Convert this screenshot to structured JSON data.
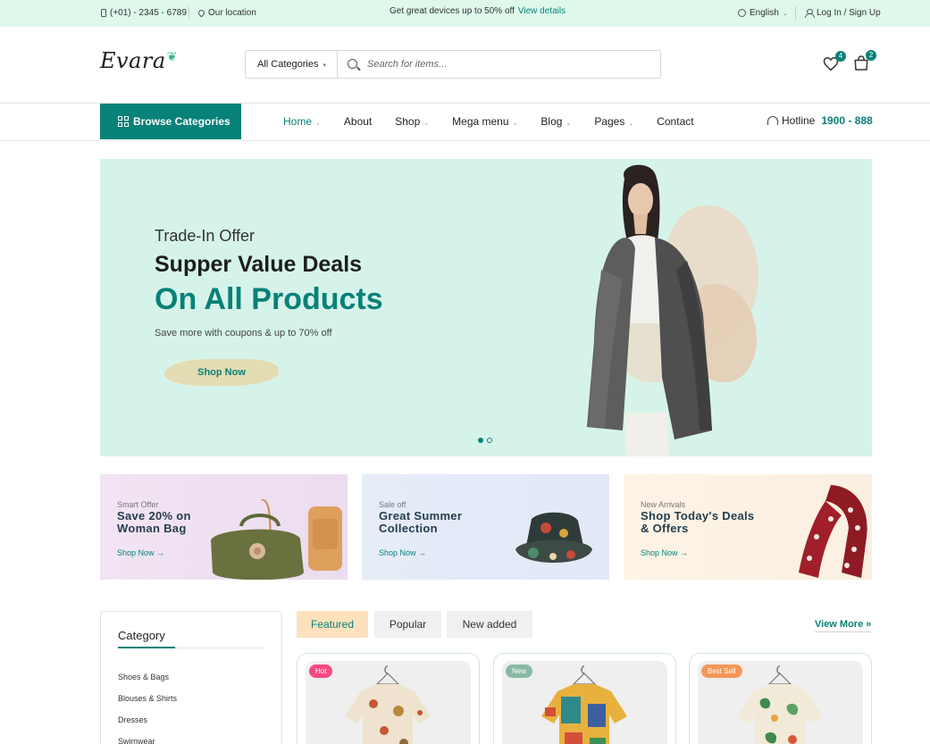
{
  "topbar": {
    "phone": "(+01) - 2345 - 6789",
    "location": "Our location",
    "promo_text": "Get great devices up to 50% off",
    "promo_link": "View details",
    "language": "English",
    "login": "Log In / Sign Up"
  },
  "header": {
    "logo": "Evara",
    "search_category": "All Categories",
    "search_placeholder": "Search for items...",
    "wishlist_count": "4",
    "cart_count": "2"
  },
  "nav": {
    "browse_label": "Browse Categories",
    "items": [
      {
        "label": "Home",
        "dropdown": true,
        "active": true
      },
      {
        "label": "About",
        "dropdown": false,
        "active": false
      },
      {
        "label": "Shop",
        "dropdown": true,
        "active": false
      },
      {
        "label": "Mega menu",
        "dropdown": true,
        "active": false
      },
      {
        "label": "Blog",
        "dropdown": true,
        "active": false
      },
      {
        "label": "Pages",
        "dropdown": true,
        "active": false
      },
      {
        "label": "Contact",
        "dropdown": false,
        "active": false
      }
    ],
    "hotline_label": "Hotline",
    "hotline_number": "1900 - 888"
  },
  "hero": {
    "pretitle": "Trade-In Offer",
    "title": "Supper Value Deals",
    "title_accent": "On All Products",
    "subtitle": "Save more with coupons & up to 70% off",
    "cta": "Shop Now",
    "slide_count": 2,
    "active_slide": 1
  },
  "banners": [
    {
      "small": "Smart Offer",
      "title": "Save 20% on Woman Bag",
      "link": "Shop Now →"
    },
    {
      "small": "Sale off",
      "title": "Great Summer Collection",
      "link": "Shop Now →"
    },
    {
      "small": "New Arrivals",
      "title": "Shop Today's Deals & Offers",
      "link": "Shop Now →"
    }
  ],
  "sidebar": {
    "title": "Category",
    "items": [
      "Shoes & Bags",
      "Blouses & Shirts",
      "Dresses",
      "Swimwear"
    ]
  },
  "tabs": [
    {
      "label": "Featured",
      "active": true
    },
    {
      "label": "Popular",
      "active": false
    },
    {
      "label": "New added",
      "active": false
    }
  ],
  "view_more": "View More »",
  "products": [
    {
      "tag": "Hot"
    },
    {
      "tag": "New"
    },
    {
      "tag": "Best Sell"
    }
  ],
  "colors": {
    "brand": "#088178",
    "topbar_bg": "#def9ec",
    "hero_bg": "#d6f3ea",
    "tab_active": "#fde1bd"
  }
}
